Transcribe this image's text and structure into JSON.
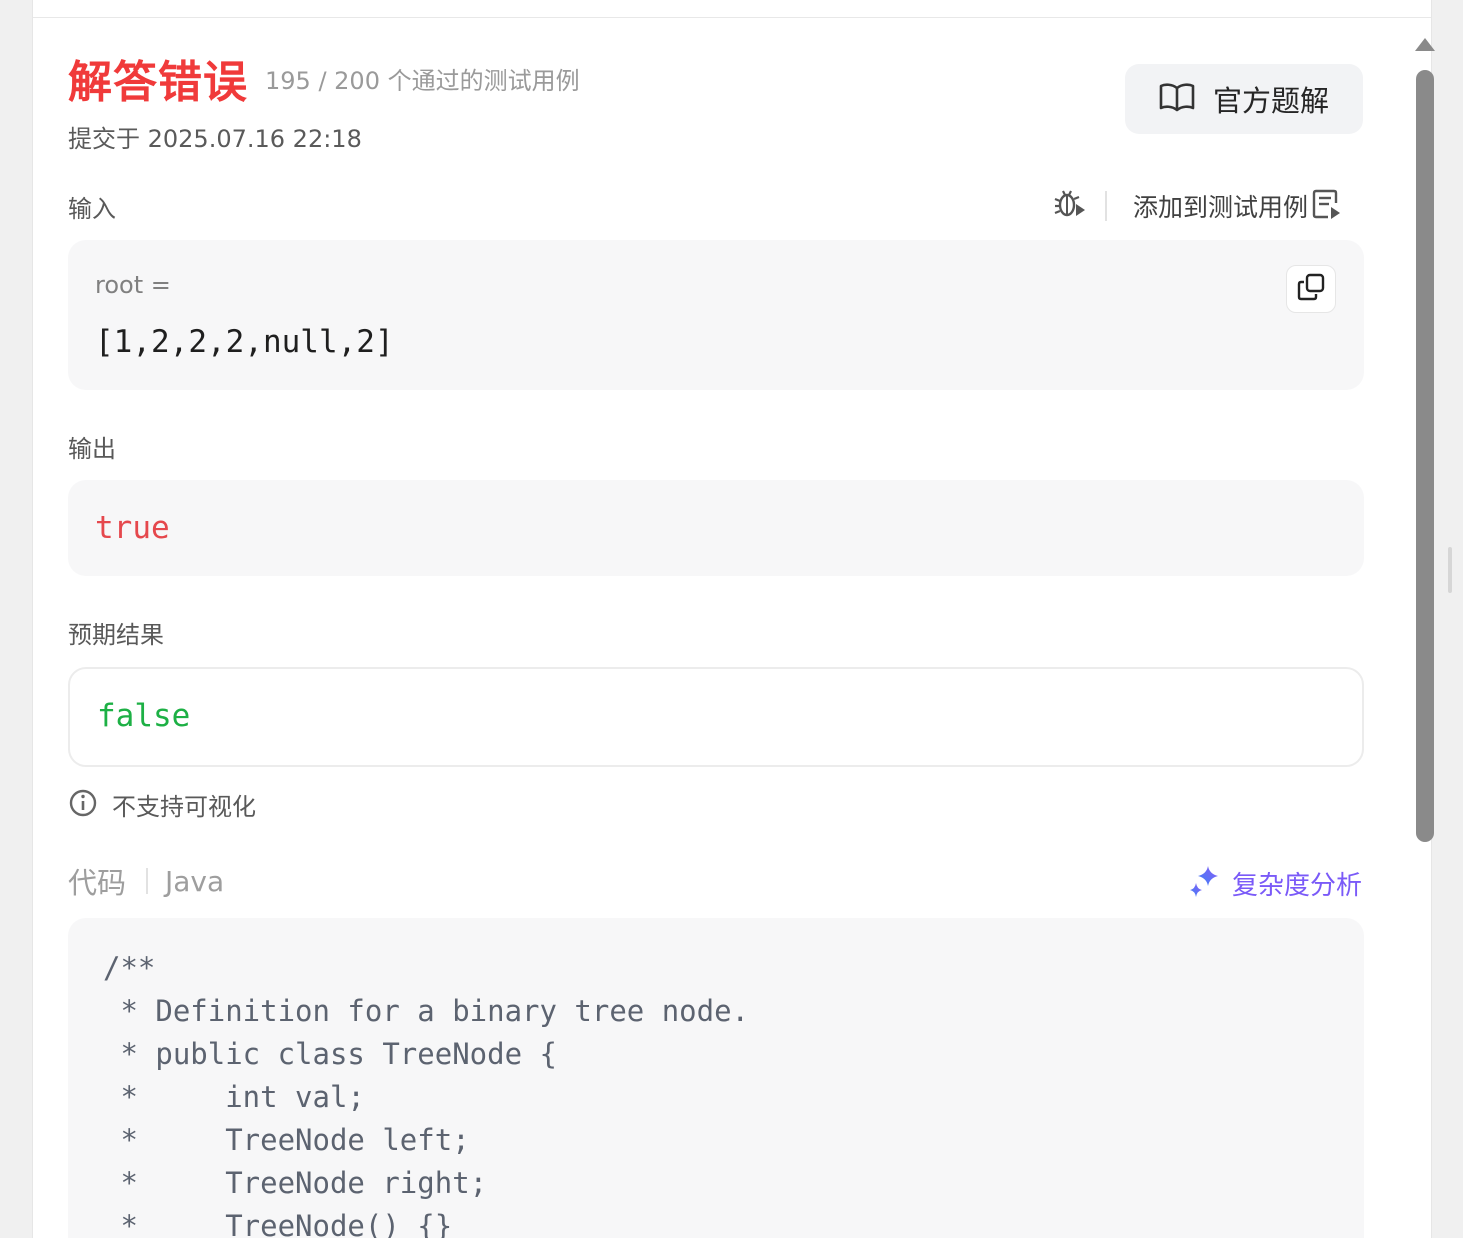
{
  "header": {
    "status": "解答错误",
    "passed_count": "195 / 200 个通过的测试用例",
    "submitted_at": "提交于 2025.07.16 22:18",
    "solution_button": "官方题解"
  },
  "input": {
    "label": "输入",
    "add_test_case": "添加到测试用例",
    "var_name": "root =",
    "value": "[1,2,2,2,null,2]"
  },
  "output": {
    "label": "输出",
    "value": "true",
    "color": "#e5484d"
  },
  "expected": {
    "label": "预期结果",
    "value": "false",
    "color": "#1db045"
  },
  "note": {
    "text": "不支持可视化"
  },
  "code": {
    "label": "代码",
    "language": "Java",
    "complexity_link": "复杂度分析",
    "lines": [
      "/**",
      " * Definition for a binary tree node.",
      " * public class TreeNode {",
      " *     int val;",
      " *     TreeNode left;",
      " *     TreeNode right;",
      " *     TreeNode() {}"
    ]
  },
  "colors": {
    "error": "#f03a3a",
    "accent_purple": "#7a5af8",
    "accent_blue": "#3b82f6"
  },
  "icons": {
    "solution": "open-book-icon",
    "debug": "bug-icon",
    "add_test": "document-play-icon",
    "copy": "copy-icon",
    "info": "info-icon",
    "complexity": "sparkle-icon"
  }
}
